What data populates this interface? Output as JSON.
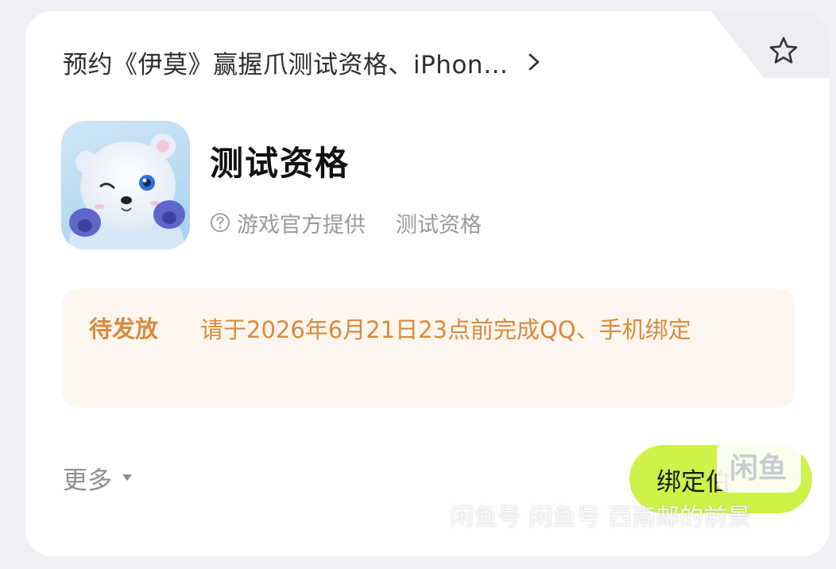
{
  "header": {
    "title": "预约《伊莫》赢握爪测试资格、iPhon…"
  },
  "app": {
    "title": "测试资格",
    "icon_name": "polar-bear-app-icon",
    "meta_source": "游戏官方提供",
    "meta_type": "测试资格"
  },
  "status": {
    "badge": "待发放",
    "message": "请于2026年6月21日23点前完成QQ、手机绑定"
  },
  "footer": {
    "more_label": "更多",
    "bind_button_label": "绑定伯"
  },
  "watermark": {
    "logo": "闲鱼",
    "text": "闲鱼号 闲鱼号 西南邮的前景"
  },
  "colors": {
    "accent_orange": "#d98a3d",
    "status_bg": "#fdf6ef",
    "button_green": "#cdf24a"
  }
}
